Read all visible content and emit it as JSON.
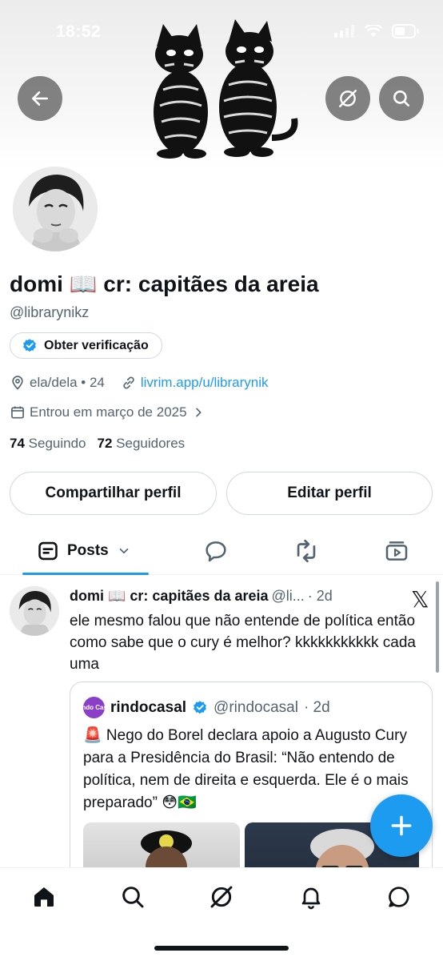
{
  "status_bar": {
    "time": "18:52"
  },
  "profile": {
    "display_name": "domi 📖 cr: capitães da areia",
    "handle": "@librarynikz",
    "verify_label": "Obter verificação",
    "pronouns_age": "ela/dela • 24",
    "website": "livrim.app/u/librarynik",
    "joined": "Entrou em março de 2025",
    "following_count": "74",
    "following_label": "Seguindo",
    "followers_count": "72",
    "followers_label": "Seguidores",
    "share_label": "Compartilhar perfil",
    "edit_label": "Editar perfil"
  },
  "tabs": {
    "posts_label": "Posts"
  },
  "tweet": {
    "name": "domi 📖 cr: capitães da areia",
    "handle": "@li...",
    "time": "· 2d",
    "text": "ele mesmo falou que não entende de política então como sabe que o cury é melhor? kkkkkkkkkkk cada uma"
  },
  "quote": {
    "avatar_text": "Rindo Casal",
    "name": "rindocasal",
    "handle": "@rindocasal",
    "time": "· 2d",
    "text": "🚨 Nego do Borel declara apoio a Augusto Cury para a Presidência do Brasil: “Não entendo de política, nem de direita e esquerda. Ele é o mais preparado” 😳🇧🇷"
  },
  "colors": {
    "accent": "#1d9bf0",
    "text": "#0f1419",
    "muted": "#536471",
    "border": "#cfd9de"
  }
}
